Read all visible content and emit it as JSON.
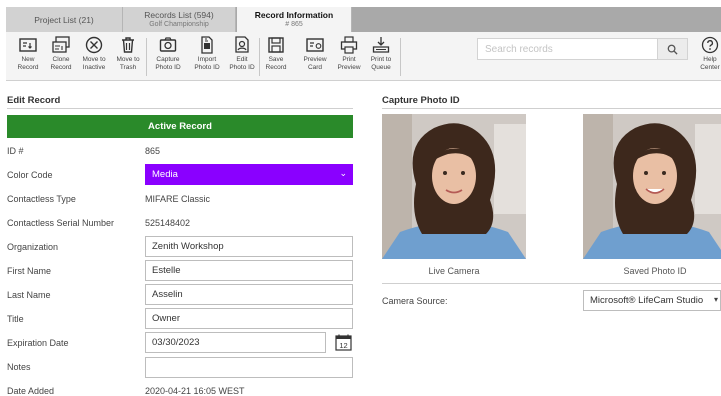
{
  "tabs": [
    {
      "title": "Project List (21)",
      "subtitle": ""
    },
    {
      "title": "Records List (594)",
      "subtitle": "Golf Championship"
    },
    {
      "title": "Record Information",
      "subtitle": "# 865"
    }
  ],
  "toolbar": {
    "buttons": [
      {
        "label": "New\nRecord",
        "icon": "new-record-icon"
      },
      {
        "label": "Clone\nRecord",
        "icon": "clone-record-icon"
      },
      {
        "label": "Move to\nInactive",
        "icon": "move-inactive-icon"
      },
      {
        "label": "Move to\nTrash",
        "icon": "trash-icon"
      },
      {
        "label": "Capture\nPhoto ID",
        "icon": "camera-icon"
      },
      {
        "label": "Import\nPhoto ID",
        "icon": "import-photo-icon"
      },
      {
        "label": "Edit\nPhoto ID",
        "icon": "edit-photo-icon"
      },
      {
        "label": "Save\nRecord",
        "icon": "save-icon"
      },
      {
        "label": "Preview\nCard",
        "icon": "preview-card-icon"
      },
      {
        "label": "Print\nPreview",
        "icon": "print-preview-icon"
      },
      {
        "label": "Print to\nQueue",
        "icon": "print-queue-icon"
      }
    ],
    "search_placeholder": "Search records",
    "help_label": "Help\nCenter"
  },
  "edit_record": {
    "title": "Edit Record",
    "status": "Active Record",
    "status_color": "#2a8a2a",
    "fields": {
      "id": {
        "label": "ID #",
        "value": "865"
      },
      "color_code": {
        "label": "Color Code",
        "value": "Media",
        "color": "#8a00ff"
      },
      "contactless_type": {
        "label": "Contactless Type",
        "value": "MIFARE Classic"
      },
      "contactless_serial": {
        "label": "Contactless Serial Number",
        "value": "525148402"
      },
      "organization": {
        "label": "Organization",
        "value": "Zenith Workshop"
      },
      "first_name": {
        "label": "First Name",
        "value": "Estelle"
      },
      "last_name": {
        "label": "Last Name",
        "value": "Asselin"
      },
      "title": {
        "label": "Title",
        "value": "Owner"
      },
      "expiration_date": {
        "label": "Expiration Date",
        "value": "03/30/2023",
        "calendar_day": "12"
      },
      "notes": {
        "label": "Notes",
        "value": ""
      },
      "date_added": {
        "label": "Date Added",
        "value": "2020-04-21 16:05 WEST"
      }
    }
  },
  "capture": {
    "title": "Capture Photo ID",
    "live_label": "Live Camera",
    "saved_label": "Saved Photo ID",
    "camera_source_label": "Camera Source:",
    "camera_source_value": "Microsoft® LifeCam Studio"
  }
}
